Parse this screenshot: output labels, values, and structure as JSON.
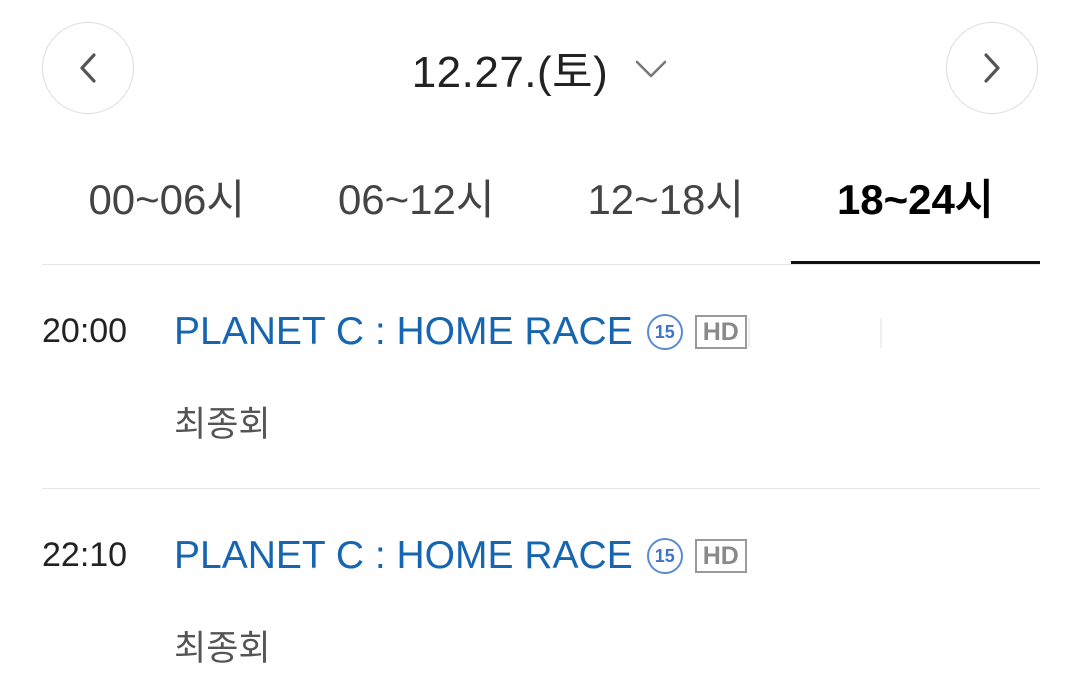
{
  "header": {
    "date": "12.27.(토)",
    "prev_icon": "chevron-left-icon",
    "next_icon": "chevron-right-icon",
    "dropdown_icon": "chevron-down-icon"
  },
  "time_tabs": [
    {
      "label": "00~06시",
      "active": false
    },
    {
      "label": "06~12시",
      "active": false
    },
    {
      "label": "12~18시",
      "active": false
    },
    {
      "label": "18~24시",
      "active": true
    }
  ],
  "programs": [
    {
      "time": "20:00",
      "title": "PLANET C : HOME RACE",
      "age_rating": "15",
      "quality": "HD",
      "subtitle": "최종회"
    },
    {
      "time": "22:10",
      "title": "PLANET C : HOME RACE",
      "age_rating": "15",
      "quality": "HD",
      "subtitle": "최종회"
    }
  ],
  "colors": {
    "title_link": "#1565b0",
    "active_tab_underline": "#111111",
    "divider": "#e6e6e6",
    "age_badge": "#3f74c6",
    "hd_badge": "#8a8a8a"
  }
}
